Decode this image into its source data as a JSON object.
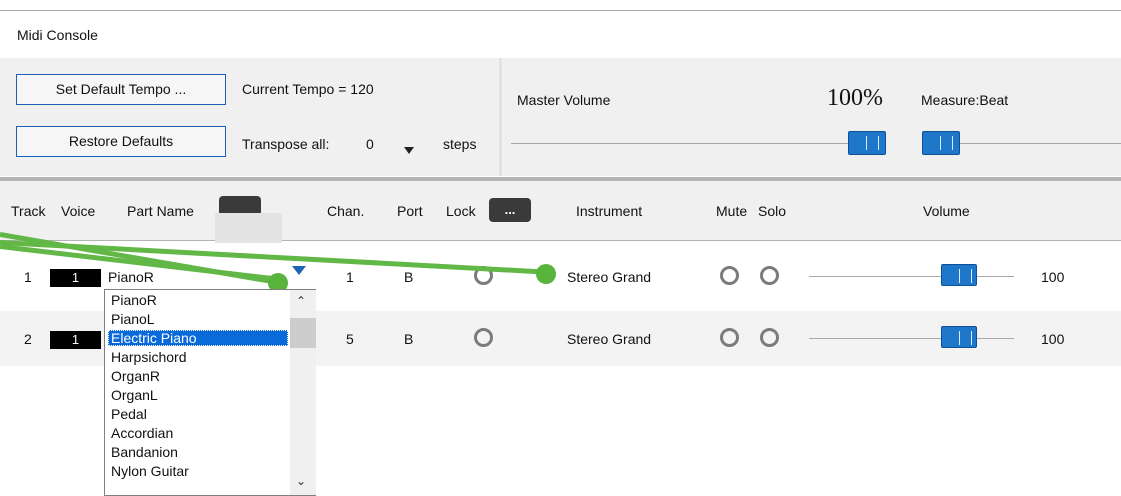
{
  "window": {
    "title": "Midi Console"
  },
  "controls": {
    "set_default_tempo": "Set Default Tempo ...",
    "current_tempo_label": "Current Tempo = ",
    "current_tempo_value": "120",
    "restore_defaults": "Restore Defaults",
    "transpose_label": "Transpose all:",
    "transpose_value": "0",
    "transpose_unit": "steps",
    "master_volume_label": "Master Volume",
    "master_volume_value": "100%",
    "measure_beat_label": "Measure:Beat"
  },
  "header": {
    "track": "Track",
    "voice": "Voice",
    "part_name": "Part Name",
    "chan": "Chan.",
    "port": "Port",
    "lock": "Lock",
    "lock_btn": "...",
    "instrument": "Instrument",
    "mute": "Mute",
    "solo": "Solo",
    "volume": "Volume"
  },
  "rows": [
    {
      "track": "1",
      "voice": "1",
      "part_name": "PianoR",
      "chan": "1",
      "port": "B",
      "instrument": "Stereo Grand",
      "volume": "100"
    },
    {
      "track": "2",
      "voice": "1",
      "part_name": "",
      "chan": "5",
      "port": "B",
      "instrument": "Stereo Grand",
      "volume": "100"
    }
  ],
  "part_dropdown": {
    "selected": "Electric Piano",
    "options": [
      "PianoR",
      "PianoL",
      "Electric Piano",
      "Harpsichord",
      "OrganR",
      "OrganL",
      "Pedal",
      "Accordian",
      "Bandanion",
      "Nylon Guitar"
    ],
    "scroll_up_icon": "chevron-up-icon",
    "scroll_down_icon": "chevron-down-icon"
  },
  "colors": {
    "accent_blue": "#1f77c9",
    "selection_blue": "#0b6ad9",
    "annotation_green": "#62b847",
    "panel_gray": "#f0f0f0"
  }
}
